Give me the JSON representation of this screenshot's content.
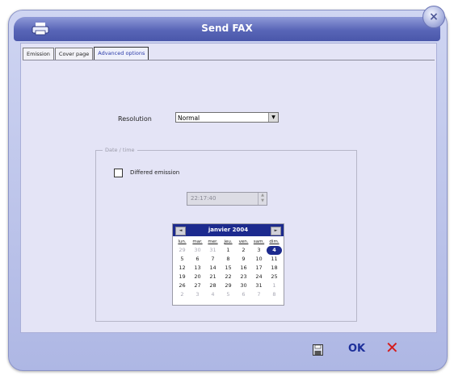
{
  "window": {
    "title": "Send FAX",
    "close_glyph": "×"
  },
  "tabs": [
    {
      "label": "Emission",
      "active": false
    },
    {
      "label": "Cover page",
      "active": false
    },
    {
      "label": "Advanced options",
      "active": true
    }
  ],
  "resolution": {
    "label": "Resolution",
    "value": "Normal",
    "arrow": "▼"
  },
  "datetime_group": {
    "legend": "Date / time",
    "deferred_label": "Differed emission",
    "deferred_checked": false,
    "time_value": "22:17:40",
    "spin_up": "▲",
    "spin_down": "▼"
  },
  "calendar": {
    "title": "janvier 2004",
    "prev": "◄",
    "next": "►",
    "weekdays": [
      "lun.",
      "mar.",
      "mer.",
      "jeu.",
      "ven.",
      "sam.",
      "dim."
    ],
    "weeks": [
      [
        {
          "d": "29",
          "out": true
        },
        {
          "d": "30",
          "out": true
        },
        {
          "d": "31",
          "out": true
        },
        {
          "d": "1"
        },
        {
          "d": "2"
        },
        {
          "d": "3"
        },
        {
          "d": "4",
          "today": true
        }
      ],
      [
        {
          "d": "5"
        },
        {
          "d": "6"
        },
        {
          "d": "7"
        },
        {
          "d": "8"
        },
        {
          "d": "9"
        },
        {
          "d": "10"
        },
        {
          "d": "11"
        }
      ],
      [
        {
          "d": "12"
        },
        {
          "d": "13"
        },
        {
          "d": "14"
        },
        {
          "d": "15"
        },
        {
          "d": "16"
        },
        {
          "d": "17"
        },
        {
          "d": "18"
        }
      ],
      [
        {
          "d": "19"
        },
        {
          "d": "20"
        },
        {
          "d": "21"
        },
        {
          "d": "22"
        },
        {
          "d": "23"
        },
        {
          "d": "24"
        },
        {
          "d": "25"
        }
      ],
      [
        {
          "d": "26"
        },
        {
          "d": "27"
        },
        {
          "d": "28"
        },
        {
          "d": "29"
        },
        {
          "d": "30"
        },
        {
          "d": "31"
        },
        {
          "d": "1",
          "out": true
        }
      ],
      [
        {
          "d": "2",
          "out": true
        },
        {
          "d": "3",
          "out": true
        },
        {
          "d": "4",
          "out": true
        },
        {
          "d": "5",
          "out": true
        },
        {
          "d": "6",
          "out": true
        },
        {
          "d": "7",
          "out": true
        },
        {
          "d": "8",
          "out": true
        }
      ]
    ]
  },
  "actions": {
    "ok_label": "OK",
    "cancel_glyph": "✕",
    "save_icon": "floppy-disk-icon"
  },
  "colors": {
    "title_bar": "#5865b7",
    "calendar_header": "#1c2a8e",
    "cancel": "#d41c1c",
    "ok": "#1d2f9a"
  }
}
